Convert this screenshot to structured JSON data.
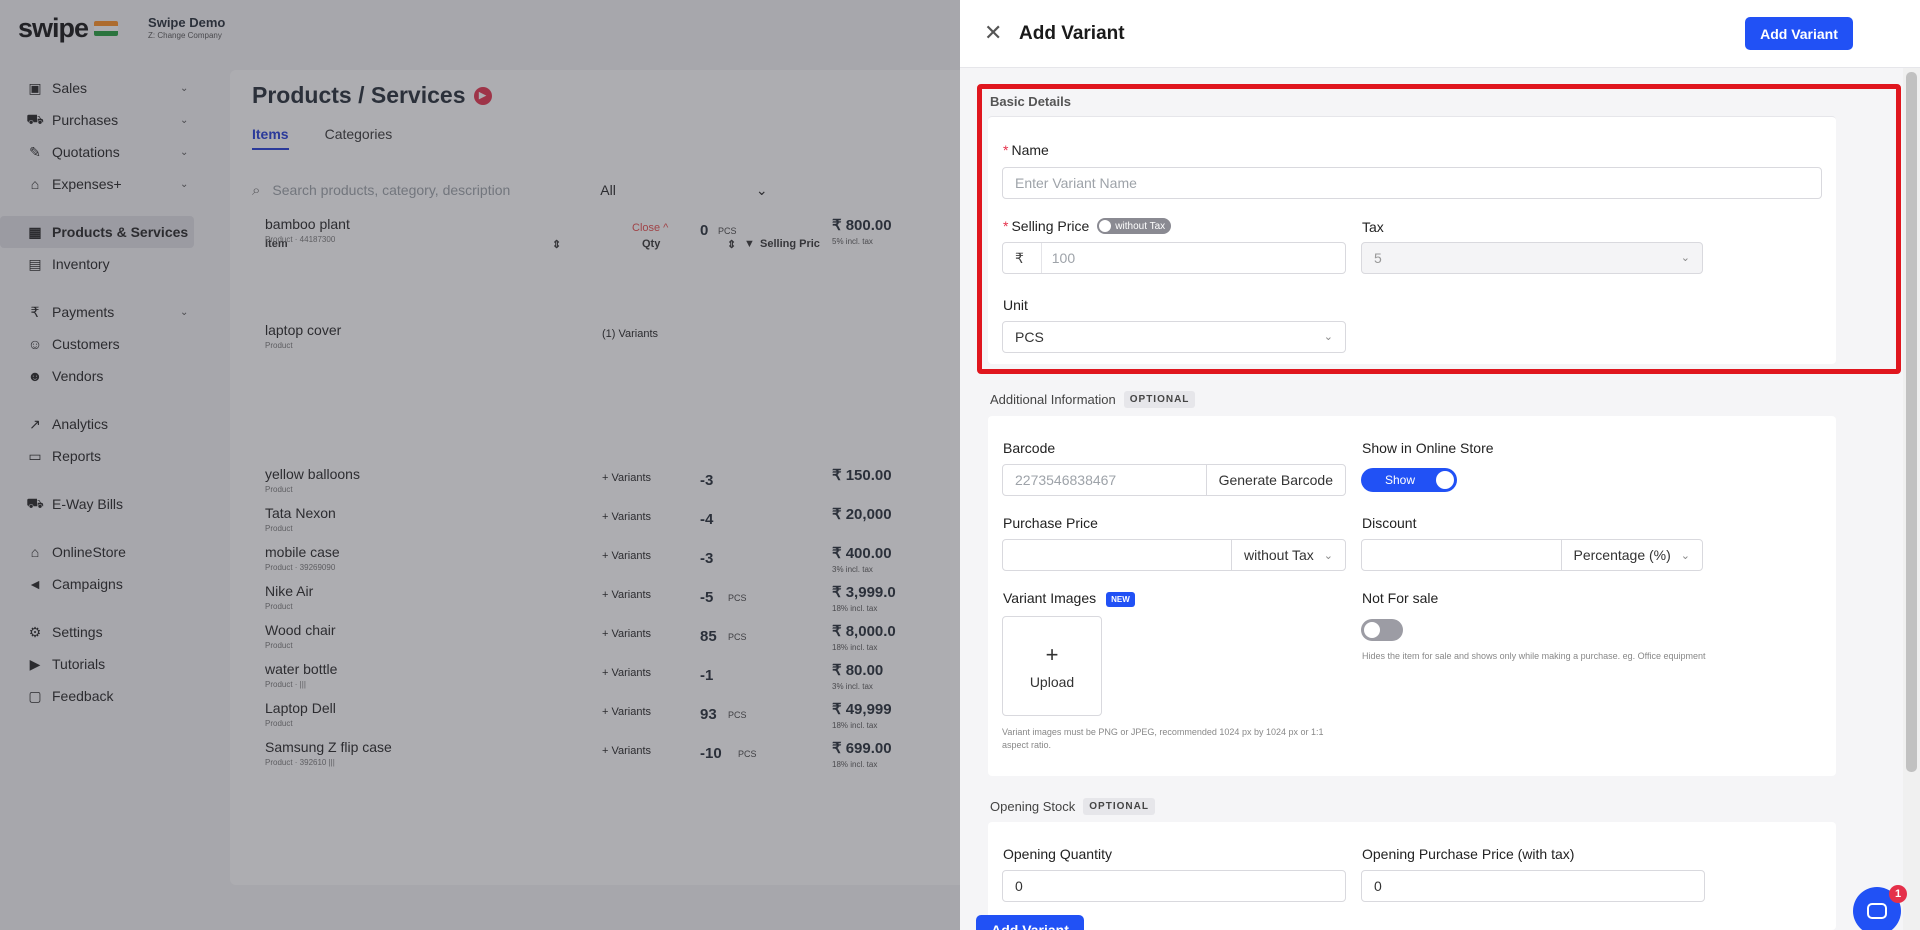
{
  "app": {
    "brand": "swipe",
    "company_name": "Swipe Demo",
    "company_type": "Z: Change Company"
  },
  "sidebar": {
    "items": [
      {
        "label": "Sales",
        "icon": "sales-icon",
        "glyph": "▣",
        "chevron": true
      },
      {
        "label": "Purchases",
        "icon": "cart-icon",
        "glyph": "⛟",
        "chevron": true
      },
      {
        "label": "Quotations",
        "icon": "pen-icon",
        "glyph": "✎",
        "chevron": true
      },
      {
        "label": "Expenses+",
        "icon": "tag-icon",
        "glyph": "⌂",
        "chevron": true
      },
      {
        "label": "Products & Services",
        "icon": "products-icon",
        "glyph": "▦",
        "active": true
      },
      {
        "label": "Inventory",
        "icon": "inventory-icon",
        "glyph": "▤"
      },
      {
        "label": "Payments",
        "icon": "rupee-icon",
        "glyph": "₹",
        "chevron": true
      },
      {
        "label": "Customers",
        "icon": "user-icon",
        "glyph": "☺"
      },
      {
        "label": "Vendors",
        "icon": "users-icon",
        "glyph": "☻"
      },
      {
        "label": "Analytics",
        "icon": "analytics-icon",
        "glyph": "↗"
      },
      {
        "label": "Reports",
        "icon": "report-icon",
        "glyph": "▭"
      },
      {
        "label": "E-Way Bills",
        "icon": "truck-icon",
        "glyph": "⛟"
      },
      {
        "label": "OnlineStore",
        "icon": "store-icon",
        "glyph": "⌂"
      },
      {
        "label": "Campaigns",
        "icon": "megaphone-icon",
        "glyph": "◄"
      },
      {
        "label": "Settings",
        "icon": "gear-icon",
        "glyph": "⚙"
      },
      {
        "label": "Tutorials",
        "icon": "play-icon",
        "glyph": "▶"
      },
      {
        "label": "Feedback",
        "icon": "chat-icon",
        "glyph": "▢"
      }
    ]
  },
  "page": {
    "title": "Products / Services",
    "tabs": [
      "Items",
      "Categories"
    ],
    "search_placeholder": "Search products, category, description",
    "filter_value": "All",
    "columns": {
      "item": "Item",
      "qty": "Qty",
      "price": "Selling Pric"
    },
    "rows": [
      {
        "name": "bamboo plant",
        "sub": "Product · 44187300",
        "action": "Close ^",
        "qty": "0",
        "unit": "PCS",
        "price": "₹ 800.00",
        "tax": "5% incl. tax"
      },
      {
        "name": "laptop cover",
        "sub": "Product",
        "action": "(1) Variants",
        "qty": "",
        "unit": "",
        "price": "",
        "tax": ""
      },
      {
        "name": "yellow balloons",
        "sub": "Product",
        "action": "+ Variants",
        "qty": "-3",
        "unit": "",
        "price": "₹ 150.00",
        "tax": ""
      },
      {
        "name": "Tata Nexon",
        "sub": "Product",
        "action": "+ Variants",
        "qty": "-4",
        "unit": "",
        "price": "₹ 20,000",
        "tax": ""
      },
      {
        "name": "mobile case",
        "sub": "Product · 39269090",
        "action": "+ Variants",
        "qty": "-3",
        "unit": "",
        "price": "₹ 400.00",
        "tax": "3% incl. tax"
      },
      {
        "name": "Nike Air",
        "sub": "Product",
        "action": "+ Variants",
        "qty": "-5",
        "unit": "PCS",
        "price": "₹ 3,999.0",
        "tax": "18% incl. tax"
      },
      {
        "name": "Wood chair",
        "sub": "Product",
        "action": "+ Variants",
        "qty": "85",
        "unit": "PCS",
        "price": "₹ 8,000.0",
        "tax": "18% incl. tax"
      },
      {
        "name": "water bottle",
        "sub": "Product · |||",
        "action": "+ Variants",
        "qty": "-1",
        "unit": "",
        "price": "₹ 80.00",
        "tax": "3% incl. tax"
      },
      {
        "name": "Laptop Dell",
        "sub": "Product",
        "action": "+ Variants",
        "qty": "93",
        "unit": "PCS",
        "price": "₹ 49,999",
        "tax": "18% incl. tax"
      },
      {
        "name": "Samsung Z flip case",
        "sub": "Product · 392610 |||",
        "action": "+ Variants",
        "qty": "-10",
        "unit": "PCS",
        "price": "₹ 699.00",
        "tax": "18% incl. tax"
      }
    ]
  },
  "drawer": {
    "title": "Add Variant",
    "header_button": "Add Variant",
    "footer_button": "Add Variant",
    "basic": {
      "section_label": "Basic Details",
      "name_label": "Name",
      "name_placeholder": "Enter Variant Name",
      "price_label": "Selling Price",
      "price_toggle": "without Tax",
      "currency": "₹",
      "price_placeholder": "100",
      "tax_label": "Tax",
      "tax_value": "5",
      "unit_label": "Unit",
      "unit_value": "PCS"
    },
    "additional": {
      "section_label": "Additional Information",
      "optional": "OPTIONAL",
      "barcode_label": "Barcode",
      "barcode_placeholder": "2273546838467",
      "generate_button": "Generate Barcode",
      "online_label": "Show in Online Store",
      "online_toggle": "Show",
      "purchase_label": "Purchase Price",
      "purchase_suffix": "without Tax",
      "discount_label": "Discount",
      "discount_suffix": "Percentage (%)",
      "images_label": "Variant Images",
      "new_badge": "NEW",
      "upload_label": "Upload",
      "images_hint": "Variant images must be PNG or JPEG, recommended 1024 px by 1024 px or 1:1 aspect ratio.",
      "nfs_label": "Not For sale",
      "nfs_hint": "Hides the item for sale and shows only while making a purchase. eg. Office equipment"
    },
    "stock": {
      "section_label": "Opening Stock",
      "optional": "OPTIONAL",
      "qty_label": "Opening Quantity",
      "qty_value": "0",
      "pprice_label": "Opening Purchase Price (with tax)",
      "pprice_value": "0"
    }
  },
  "chat": {
    "badge": "1"
  },
  "colors": {
    "accent": "#2151f5",
    "highlight": "#e0161e",
    "required": "#e5304a"
  }
}
